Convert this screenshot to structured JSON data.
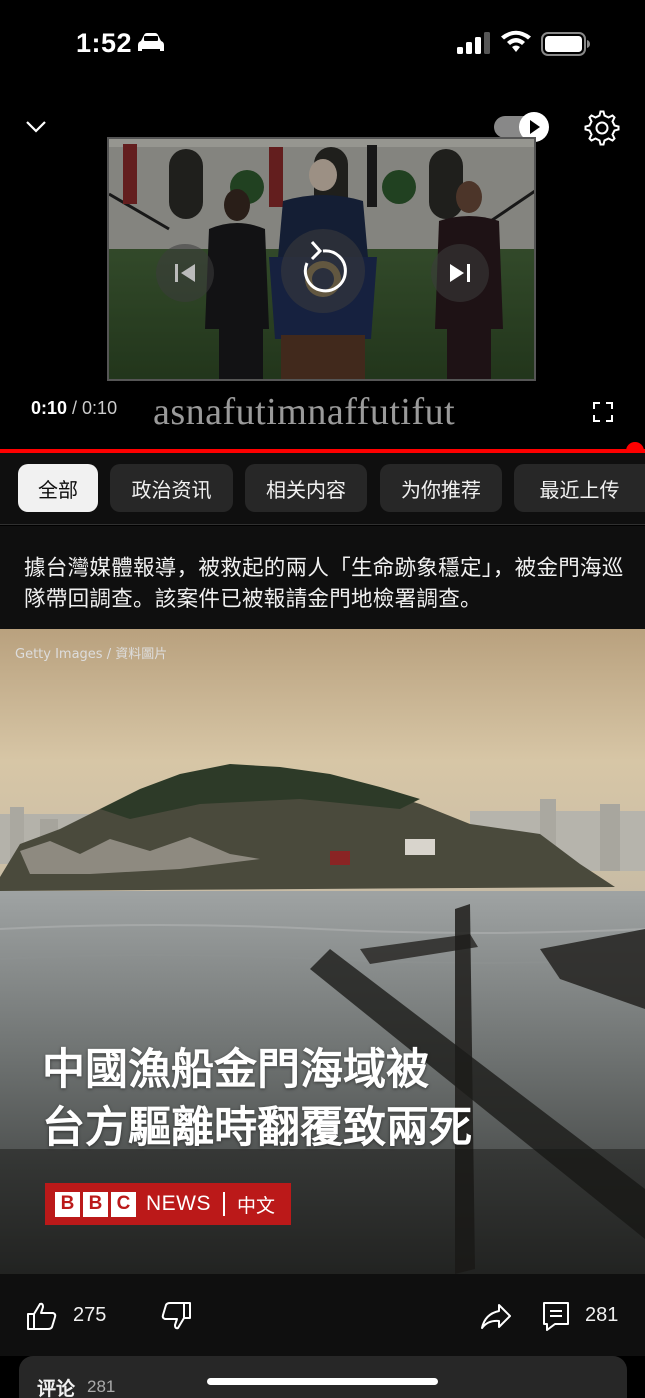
{
  "status_bar": {
    "time": "1:52",
    "icons": [
      "car-icon",
      "cellular-signal-icon",
      "wifi-icon",
      "battery-icon"
    ]
  },
  "player": {
    "current_time": "0:10",
    "separator": " / ",
    "duration": "0:10",
    "overlay_text": "asnafutimnaffutifut",
    "progress": 1.0,
    "autoplay": true,
    "icons": [
      "chevron-down-icon",
      "autoplay-toggle-icon",
      "gear-icon",
      "skip-previous-icon",
      "replay-icon",
      "skip-next-icon",
      "fullscreen-icon"
    ]
  },
  "chips": [
    {
      "label": "全部",
      "active": true
    },
    {
      "label": "政治资讯",
      "active": false
    },
    {
      "label": "相关内容",
      "active": false
    },
    {
      "label": "为你推荐",
      "active": false
    },
    {
      "label": "最近上传",
      "active": false
    }
  ],
  "description": {
    "text": "據台灣媒體報導，被救起的兩人「生命跡象穩定」，被金門海巡隊帶回調查。該案件已被報請金門地檢署調查。"
  },
  "image": {
    "credit": "Getty Images / 資料圖片",
    "headline_line1": "中國漁船金門海域被",
    "headline_line2": "台方驅離時翻覆致兩死",
    "badge": {
      "letters": [
        "B",
        "B",
        "C"
      ],
      "news": "NEWS",
      "lang": "中文"
    }
  },
  "actions": {
    "likes": "275",
    "comments": "281",
    "icons": [
      "thumbs-up-icon",
      "thumbs-down-icon",
      "share-icon",
      "comment-icon"
    ]
  },
  "comments_panel": {
    "label": "评论",
    "count": "281"
  },
  "colors": {
    "accent_red": "#ff0000",
    "bbc_red": "#bb1919",
    "chip_bg": "#272727",
    "chip_active_bg": "#f1f1f1"
  }
}
